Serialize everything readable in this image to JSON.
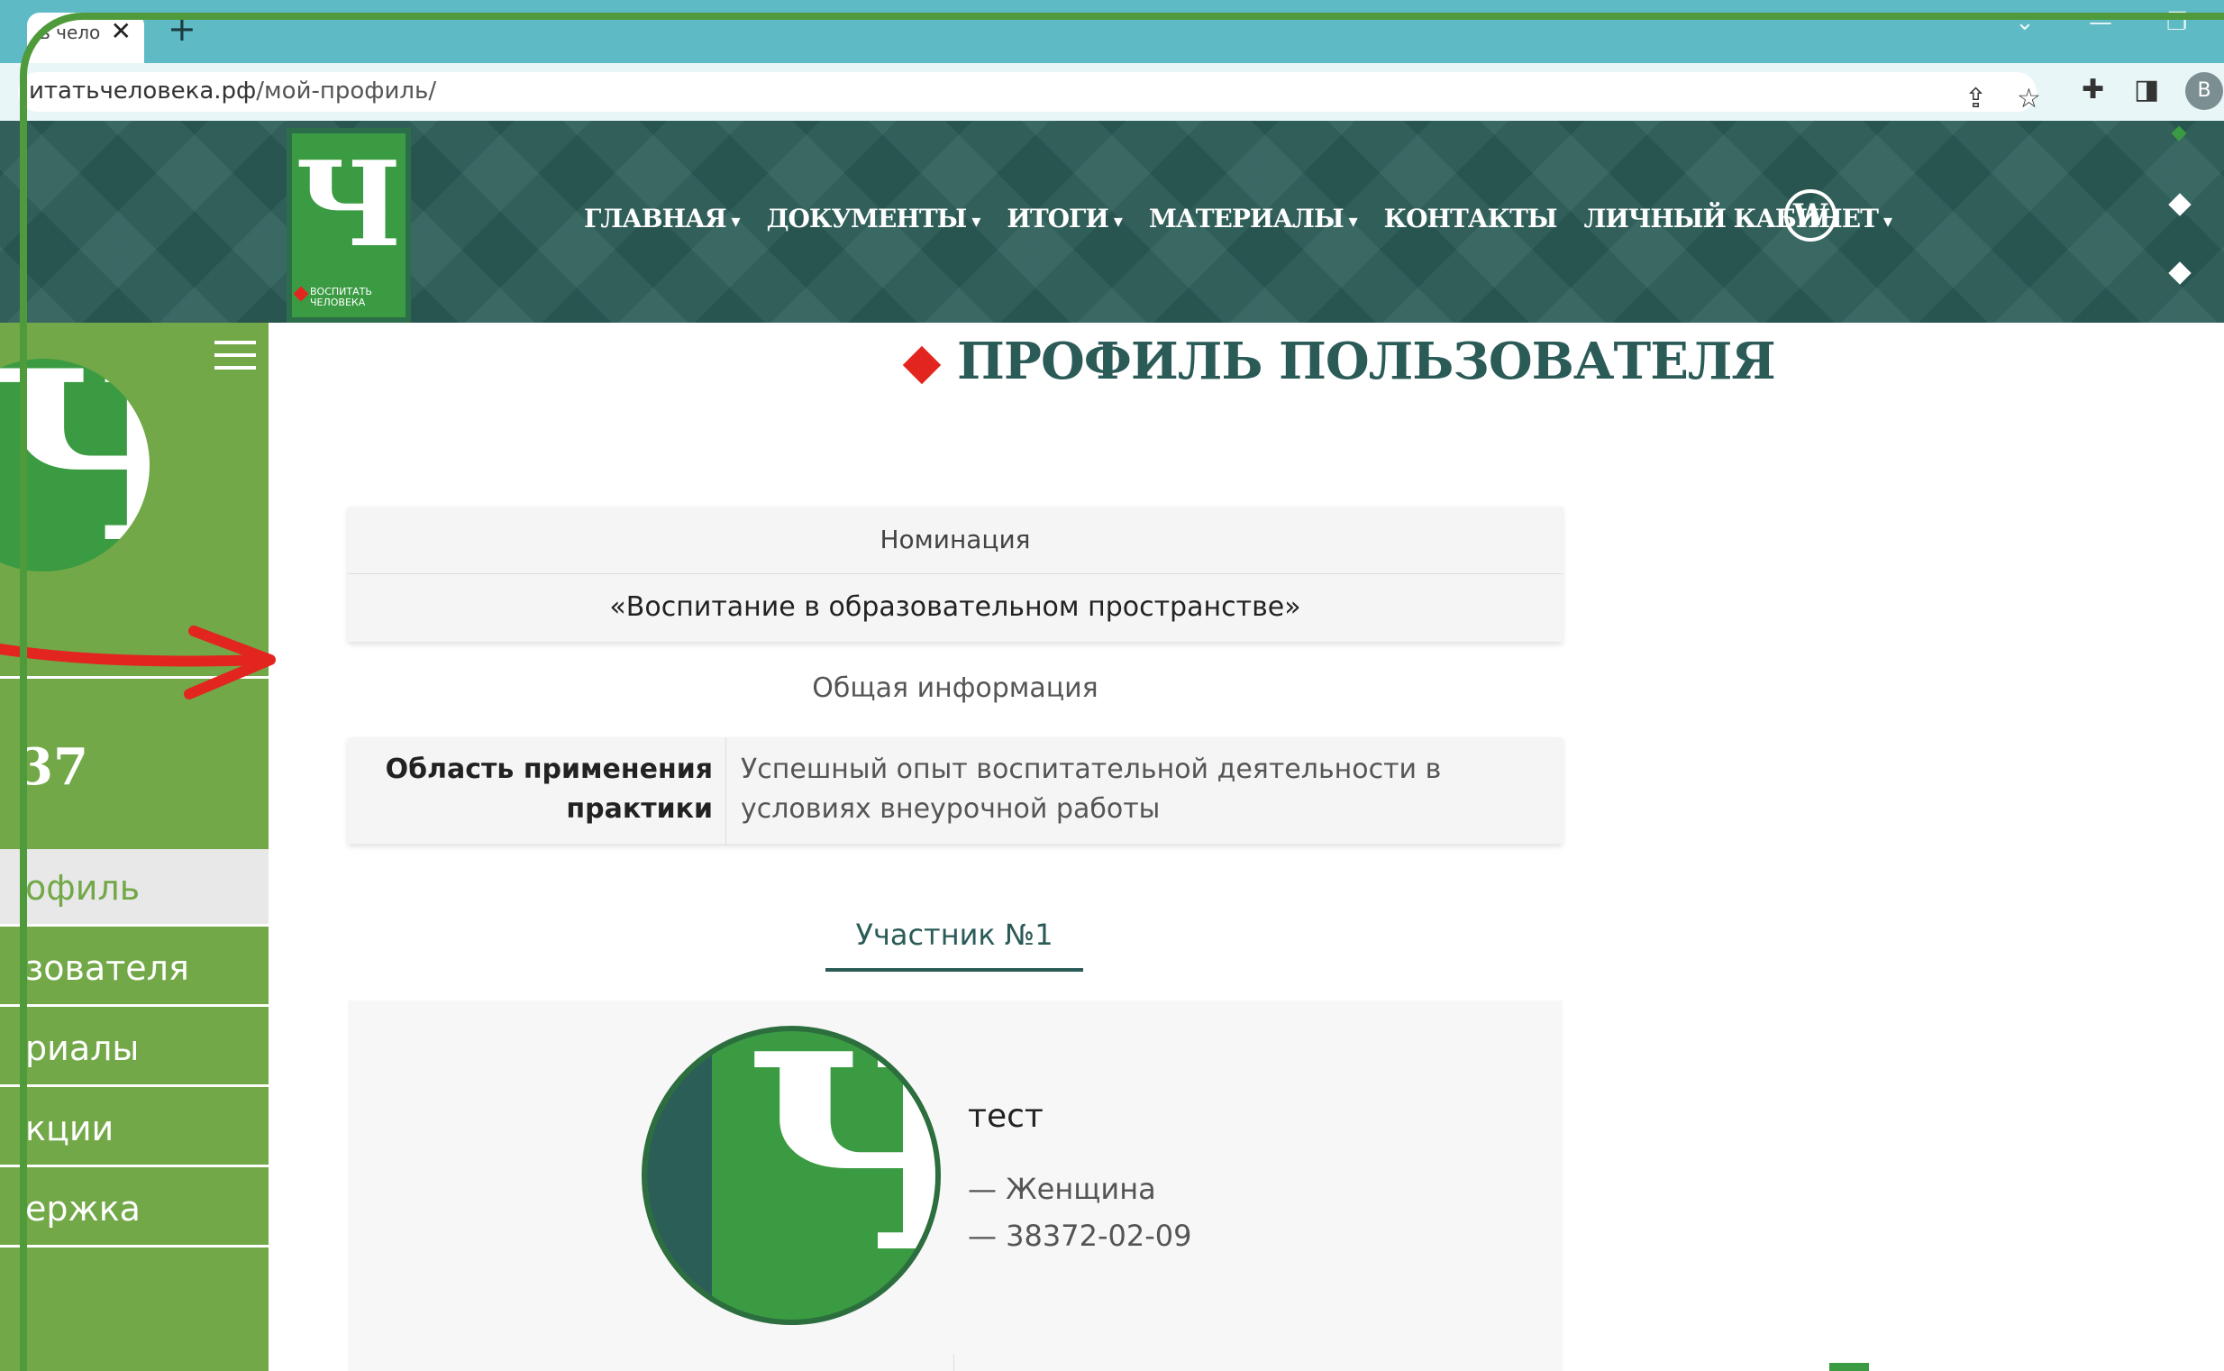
{
  "browser": {
    "tab_title": "ь чело",
    "tab_close": "✕",
    "new_tab": "+",
    "url_host": "итатьчеловека.рф",
    "url_path": "/мой-профиль/",
    "profile_initial": "B",
    "win_min": "—",
    "win_max": "❐",
    "win_down": "⌄"
  },
  "header": {
    "logo_letter": "Ч",
    "logo_caption_1": "ВОСПИТАТЬ",
    "logo_caption_2": "ЧЕЛОВЕКА",
    "nav": [
      {
        "label": "ГЛАВНАЯ",
        "caret": "▾"
      },
      {
        "label": "ДОКУМЕНТЫ",
        "caret": "▾"
      },
      {
        "label": "ИТОГИ",
        "caret": "▾"
      },
      {
        "label": "МАТЕРИАЛЫ",
        "caret": "▾"
      },
      {
        "label": "КОНТАКТЫ",
        "caret": ""
      },
      {
        "label": "ЛИЧНЫЙ КАБИНЕТ",
        "caret": "▾"
      }
    ],
    "wp_letter": "W"
  },
  "sidebar": {
    "logo_letter": "Ч",
    "number": "37",
    "items": [
      {
        "label": "офиль"
      },
      {
        "label": "зователя"
      },
      {
        "label": "риалы"
      },
      {
        "label": "кции"
      },
      {
        "label": "ержка"
      }
    ]
  },
  "main": {
    "title": "ПРОФИЛЬ ПОЛЬЗОВАТЕЛЯ",
    "nomination_header": "Номинация",
    "nomination_value": "«Воспитание в образовательном пространстве»",
    "general_info": "Общая информация",
    "info_key": "Область применения практики",
    "info_value": "Успешный опыт воспитательной деятельности в условиях внеурочной работы",
    "participant_tab": "Участник №1",
    "participant": {
      "avatar_letter": "Ч",
      "name": "тест",
      "gender": "— Женщина",
      "date": "— 38372-02-09"
    }
  },
  "colors": {
    "header_bg": "#2c5e58",
    "sidebar_bg": "#72a847",
    "logo_green": "#3a9b42",
    "accent_red": "#e3251f",
    "title_color": "#2b5b57"
  }
}
